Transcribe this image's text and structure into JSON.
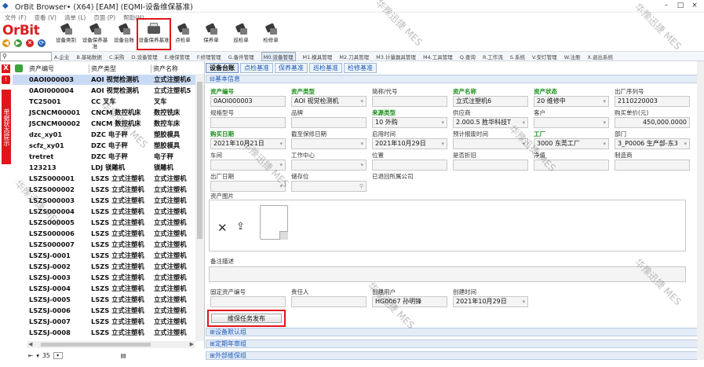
{
  "window": {
    "title": "OrBit Browser• (X64) [EAM] (EQMI-设备维保基准)",
    "controls": [
      "–",
      "□",
      "×"
    ]
  },
  "menubar": [
    "文件 (F)",
    "查看 (V)",
    "清单 (L)",
    "页面 (P)",
    "帮助(H)"
  ],
  "logo": {
    "text": "OrBit"
  },
  "toolbar": [
    {
      "label": "设备类别"
    },
    {
      "label": "设备保养基准"
    },
    {
      "label": "设备台账"
    },
    {
      "label": "设备保养基准"
    },
    {
      "label": "点检单"
    },
    {
      "label": "保养单"
    },
    {
      "label": "巡检单"
    },
    {
      "label": "检修单"
    }
  ],
  "modules": [
    "A.企业",
    "B.基础数据",
    "C.采购",
    "D.设备管理",
    "E.维保管理",
    "F.修理管理",
    "G.备件管理",
    "M0.设备管理",
    "M1.模具管理",
    "M2.刀具管理",
    "M3.计量器具管理",
    "M4.工具管理",
    "Q.查询",
    "R.工作流",
    "S.系统",
    "V.安灯管理",
    "W.注册",
    "X.退出系统"
  ],
  "sidebar": {
    "close": "X",
    "vertical_text": "单据状态提示"
  },
  "list": {
    "headers": [
      "资产编号",
      "资产类型",
      "资产名称"
    ],
    "rows": [
      [
        "0AOI000003",
        "AOI 视觉检测机",
        "立式注塑机6"
      ],
      [
        "0AOI000004",
        "AOI 视觉检测机",
        "立式注塑机5"
      ],
      [
        "TC25001",
        "CC 叉车",
        "叉车"
      ],
      [
        "JSCNCM00001",
        "CNCM 数控机床",
        "数控铣床"
      ],
      [
        "JSCNCM00002",
        "CNCM 数控机床",
        "数控车床"
      ],
      [
        "dzc_xy01",
        "DZC 电子秤",
        "塑胶模具"
      ],
      [
        "scfz_xy01",
        "DZC 电子秤",
        "塑胶模具"
      ],
      [
        "tretret",
        "DZC 电子秤",
        "电子秤"
      ],
      [
        "123213",
        "LDJ 镁雕机",
        "镁雕机"
      ],
      [
        "LSZS000001",
        "LSZS 立式注塑机",
        "立式注塑机"
      ],
      [
        "LSZS000002",
        "LSZS 立式注塑机",
        "立式注塑机"
      ],
      [
        "LSZS000003",
        "LSZS 立式注塑机",
        "立式注塑机"
      ],
      [
        "LSZS000004",
        "LSZS 立式注塑机",
        "立式注塑机"
      ],
      [
        "LSZS000005",
        "LSZS 立式注塑机",
        "立式注塑机"
      ],
      [
        "LSZS000006",
        "LSZS 立式注塑机",
        "立式注塑机"
      ],
      [
        "LSZS000007",
        "LSZS 立式注塑机",
        "立式注塑机"
      ],
      [
        "LSZSJ-0001",
        "LSZS 立式注塑机",
        "立式注塑机"
      ],
      [
        "LSZSJ-0002",
        "LSZS 立式注塑机",
        "立式注塑机"
      ],
      [
        "LSZSJ-0003",
        "LSZS 立式注塑机",
        "立式注塑机"
      ],
      [
        "LSZSJ-0004",
        "LSZS 立式注塑机",
        "立式注塑机"
      ],
      [
        "LSZSJ-0005",
        "LSZS 立式注塑机",
        "立式注塑机"
      ],
      [
        "LSZSJ-0006",
        "LSZS 立式注塑机",
        "立式注塑机"
      ],
      [
        "LSZSJ-0007",
        "LSZS 立式注塑机",
        "立式注塑机"
      ],
      [
        "LSZSJ-0008",
        "LSZS 立式注塑机",
        "立式注塑机"
      ]
    ],
    "footer_count": "35"
  },
  "tabs": [
    "设备台账",
    "点检基准",
    "保养基准",
    "巡检基准",
    "检修基准"
  ],
  "sections": {
    "basic": "基本信息",
    "default_group": "设备默认组",
    "annual_group": "定期年审组",
    "external_group": "外部维保组"
  },
  "form": {
    "asset_no": {
      "label": "资产编号",
      "value": "0AOI000003"
    },
    "asset_type": {
      "label": "资产类型",
      "value": "AOI 视觉检测机"
    },
    "short_code": {
      "label": "简称/代号",
      "value": ""
    },
    "asset_name": {
      "label": "资产名称",
      "value": "立式注塑机6"
    },
    "asset_status": {
      "label": "资产状态",
      "value": "20 维修中"
    },
    "serial_no": {
      "label": "出厂序列号",
      "value": "2110220003"
    },
    "spec": {
      "label": "规格型号",
      "value": ""
    },
    "brand": {
      "label": "品牌",
      "value": ""
    },
    "source_type": {
      "label": "来源类型",
      "value": "10 外购"
    },
    "supplier": {
      "label": "供应商",
      "value": "2.000.5 胜华科技T"
    },
    "customer": {
      "label": "客户",
      "value": ""
    },
    "price": {
      "label": "购买单价(元)",
      "value": "450,000.0000"
    },
    "purchase_date": {
      "label": "购买日期",
      "value": "2021年10月21日"
    },
    "warranty_end": {
      "label": "截至保修日期",
      "value": ""
    },
    "start_time": {
      "label": "启用时间",
      "value": "2021年10月29日"
    },
    "scrap_time": {
      "label": "预计报废时间",
      "value": ""
    },
    "factory": {
      "label": "工厂",
      "value": "3000 东莞工厂"
    },
    "department": {
      "label": "部门",
      "value": "3_P0006 生产部-东3"
    },
    "workshop": {
      "label": "车间",
      "value": ""
    },
    "work_center": {
      "label": "工作中心",
      "value": ""
    },
    "location": {
      "label": "位置",
      "value": ""
    },
    "depreciation": {
      "label": "是否折旧",
      "value": ""
    },
    "net_value": {
      "label": "净值",
      "value": ""
    },
    "manufacturer": {
      "label": "制造商",
      "value": ""
    },
    "mfg_date": {
      "label": "出厂日期",
      "value": ""
    },
    "storage": {
      "label": "储存位",
      "value": ""
    },
    "returned": {
      "label": "已退回所属公司",
      "value": ""
    },
    "photo": {
      "label": "资产图片"
    },
    "memo": {
      "label": "备注描述"
    },
    "fixed_asset_no": {
      "label": "固定资产编号",
      "value": ""
    },
    "owner": {
      "label": "责任人",
      "value": ""
    },
    "creator": {
      "label": "创建用户",
      "value": "HG0067 孙明锋"
    },
    "create_time": {
      "label": "创建时间",
      "value": "2021年10月29日"
    }
  },
  "task_button": "维保任务发布",
  "watermark": "华豫迅捷 MES",
  "colors": {
    "accent": "#1e5bb8",
    "brand_red": "#e0161b",
    "required_green": "#1a8f1a",
    "selected_row": "#c9dbf4"
  }
}
